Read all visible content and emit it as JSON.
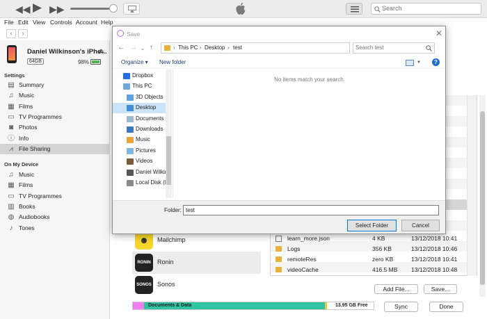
{
  "toolbar": {
    "search_placeholder": "Search"
  },
  "menu": [
    "File",
    "Edit",
    "View",
    "Controls",
    "Account",
    "Help"
  ],
  "device": {
    "name": "Daniel Wilkinson's iPho...",
    "capacity": "64GB",
    "battery": "98%"
  },
  "sidebar": {
    "settings_header": "Settings",
    "settings_items": [
      {
        "label": "Summary",
        "icon": "summary-icon",
        "glyph": "▤"
      },
      {
        "label": "Music",
        "icon": "music-icon",
        "glyph": "♫"
      },
      {
        "label": "Films",
        "icon": "films-icon",
        "glyph": "▦"
      },
      {
        "label": "TV Programmes",
        "icon": "tv-icon",
        "glyph": "▭"
      },
      {
        "label": "Photos",
        "icon": "camera-icon",
        "glyph": "◙"
      },
      {
        "label": "Info",
        "icon": "info-icon",
        "glyph": "ⓘ"
      },
      {
        "label": "File Sharing",
        "icon": "file-sharing-icon",
        "glyph": "⩘"
      }
    ],
    "device_header": "On My Device",
    "device_items": [
      {
        "label": "Music",
        "icon": "music-icon",
        "glyph": "♫"
      },
      {
        "label": "Films",
        "icon": "films-icon",
        "glyph": "▦"
      },
      {
        "label": "TV Programmes",
        "icon": "tv-icon",
        "glyph": "▭"
      },
      {
        "label": "Books",
        "icon": "books-icon",
        "glyph": "▥"
      },
      {
        "label": "Audiobooks",
        "icon": "audiobooks-icon",
        "glyph": "◍"
      },
      {
        "label": "Tones",
        "icon": "bell-icon",
        "glyph": "♪"
      }
    ]
  },
  "apps": [
    {
      "name": "Mailchimp",
      "icon_text": "☻"
    },
    {
      "name": "Ronin",
      "icon_text": "RONIN"
    },
    {
      "name": "Sonos",
      "icon_text": "SONOS"
    }
  ],
  "files": [
    {
      "name": "learn_more.json",
      "size": "4 KB",
      "date": "13/12/2018 10:41",
      "type": "file"
    },
    {
      "name": "Logs",
      "size": "356 KB",
      "date": "13/12/2018 10:46",
      "type": "folder"
    },
    {
      "name": "remoteRes",
      "size": "zero KB",
      "date": "13/12/2018 10:41",
      "type": "folder"
    },
    {
      "name": "videoCache",
      "size": "416.5 MB",
      "date": "13/12/2018 10:48",
      "type": "folder"
    }
  ],
  "buttons": {
    "add_file": "Add File...",
    "save": "Save...",
    "sync": "Sync",
    "done": "Done"
  },
  "storage": {
    "label": "Documents & Data",
    "free": "13.95 GB Free"
  },
  "colors": {
    "storage_pink": "#f07df0",
    "storage_teal": "#2fc3a0",
    "storage_yellow": "#f5c842",
    "folder_yellow": "#e5b33d"
  },
  "dialog": {
    "title": "Save",
    "breadcrumb": [
      "This PC",
      "Desktop",
      "test"
    ],
    "search_placeholder": "Search test",
    "organize": "Organize ▾",
    "new_folder": "New folder",
    "help": "?",
    "tree": [
      {
        "label": "Dropbox",
        "icon": "dropbox-icon",
        "color": "#1f6fe5",
        "indent": 0
      },
      {
        "label": "This PC",
        "icon": "computer-icon",
        "color": "#6fa8dc",
        "indent": 0
      },
      {
        "label": "3D Objects",
        "icon": "3d-objects-icon",
        "color": "#5fa2dd",
        "indent": 1
      },
      {
        "label": "Desktop",
        "icon": "desktop-icon",
        "color": "#3f8fd6",
        "indent": 1,
        "selected": true
      },
      {
        "label": "Documents",
        "icon": "documents-icon",
        "color": "#9bb6cf",
        "indent": 1
      },
      {
        "label": "Downloads",
        "icon": "downloads-icon",
        "color": "#3a78c2",
        "indent": 1
      },
      {
        "label": "Music",
        "icon": "music-folder-icon",
        "color": "#e8a33a",
        "indent": 1
      },
      {
        "label": "Pictures",
        "icon": "pictures-icon",
        "color": "#7fb7e0",
        "indent": 1
      },
      {
        "label": "Videos",
        "icon": "videos-icon",
        "color": "#7d5b3a",
        "indent": 1
      },
      {
        "label": "Daniel Wilkin",
        "icon": "phone-icon",
        "color": "#555555",
        "indent": 1
      },
      {
        "label": "Local Disk (E",
        "icon": "drive-icon",
        "color": "#8a8a8a",
        "indent": 1
      }
    ],
    "empty_message": "No items match your search.",
    "folder_label": "Folder:",
    "folder_value": "test",
    "select_folder": "Select Folder",
    "cancel": "Cancel"
  }
}
